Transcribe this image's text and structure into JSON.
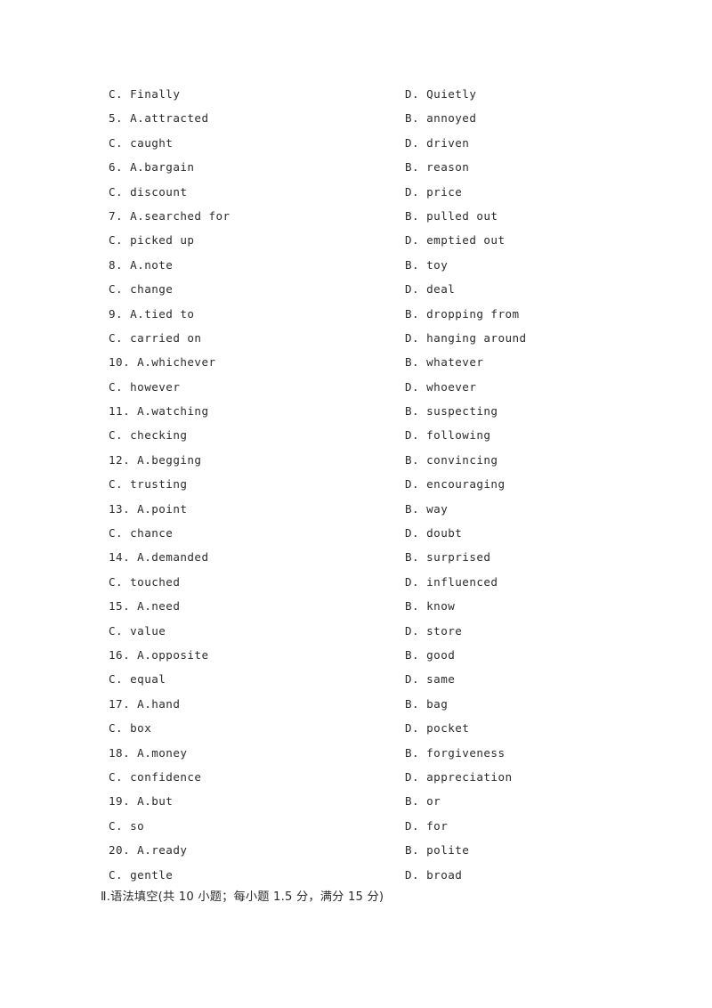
{
  "page": {
    "background_color": "#ffffff",
    "text_color": "#2b2b2b"
  },
  "cloze_options": {
    "first_partial_row": {
      "left_key": "C.",
      "left_value": "Finally",
      "right_key": "D.",
      "right_value": "Quietly"
    },
    "questions": [
      {
        "number": "5.",
        "a_key": "A.",
        "a_value": "attracted",
        "b_key": "B.",
        "b_value": "annoyed",
        "c_key": "C.",
        "c_value": "caught",
        "d_key": "D.",
        "d_value": "driven"
      },
      {
        "number": "6.",
        "a_key": "A.",
        "a_value": "bargain",
        "b_key": "B.",
        "b_value": "reason",
        "c_key": "C.",
        "c_value": "discount",
        "d_key": "D.",
        "d_value": "price"
      },
      {
        "number": "7.",
        "a_key": "A.",
        "a_value": "searched for",
        "b_key": "B.",
        "b_value": "pulled out",
        "c_key": "C.",
        "c_value": "picked up",
        "d_key": "D.",
        "d_value": "emptied out"
      },
      {
        "number": "8.",
        "a_key": "A.",
        "a_value": "note",
        "b_key": "B.",
        "b_value": "toy",
        "c_key": "C.",
        "c_value": "change",
        "d_key": "D.",
        "d_value": "deal"
      },
      {
        "number": "9.",
        "a_key": "A.",
        "a_value": "tied to",
        "b_key": "B.",
        "b_value": "dropping from",
        "c_key": "C.",
        "c_value": "carried on",
        "d_key": "D.",
        "d_value": "hanging around"
      },
      {
        "number": "10.",
        "a_key": "A.",
        "a_value": "whichever",
        "b_key": "B.",
        "b_value": "whatever",
        "c_key": "C.",
        "c_value": "however",
        "d_key": "D.",
        "d_value": "whoever"
      },
      {
        "number": "11.",
        "a_key": "A.",
        "a_value": "watching",
        "b_key": "B.",
        "b_value": "suspecting",
        "c_key": "C.",
        "c_value": "checking",
        "d_key": "D.",
        "d_value": "following"
      },
      {
        "number": "12.",
        "a_key": "A.",
        "a_value": "begging",
        "b_key": "B.",
        "b_value": "convincing",
        "c_key": "C.",
        "c_value": "trusting",
        "d_key": "D.",
        "d_value": "encouraging"
      },
      {
        "number": "13.",
        "a_key": "A.",
        "a_value": "point",
        "b_key": "B.",
        "b_value": "way",
        "c_key": "C.",
        "c_value": "chance",
        "d_key": "D.",
        "d_value": "doubt"
      },
      {
        "number": "14.",
        "a_key": "A.",
        "a_value": "demanded",
        "b_key": "B.",
        "b_value": "surprised",
        "c_key": "C.",
        "c_value": "touched",
        "d_key": "D.",
        "d_value": "influenced"
      },
      {
        "number": "15.",
        "a_key": "A.",
        "a_value": "need",
        "b_key": "B.",
        "b_value": "know",
        "c_key": "C.",
        "c_value": "value",
        "d_key": "D.",
        "d_value": "store"
      },
      {
        "number": "16.",
        "a_key": "A.",
        "a_value": "opposite",
        "b_key": "B.",
        "b_value": "good",
        "c_key": "C.",
        "c_value": "equal",
        "d_key": "D.",
        "d_value": "same"
      },
      {
        "number": "17.",
        "a_key": "A.",
        "a_value": "hand",
        "b_key": "B.",
        "b_value": "bag",
        "c_key": "C.",
        "c_value": "box",
        "d_key": "D.",
        "d_value": "pocket"
      },
      {
        "number": "18.",
        "a_key": "A.",
        "a_value": "money",
        "b_key": "B.",
        "b_value": "forgiveness",
        "c_key": "C.",
        "c_value": "confidence",
        "d_key": "D.",
        "d_value": "appreciation"
      },
      {
        "number": "19.",
        "a_key": "A.",
        "a_value": "but",
        "b_key": "B.",
        "b_value": "or",
        "c_key": "C.",
        "c_value": "so",
        "d_key": "D.",
        "d_value": "for"
      },
      {
        "number": "20.",
        "a_key": "A.",
        "a_value": "ready",
        "b_key": "B.",
        "b_value": "polite",
        "c_key": "C.",
        "c_value": "gentle",
        "d_key": "D.",
        "d_value": "broad"
      }
    ]
  },
  "section_heading": {
    "text": "Ⅱ.语法填空(共 10 小题；每小题 1.5 分，满分 15 分)"
  }
}
